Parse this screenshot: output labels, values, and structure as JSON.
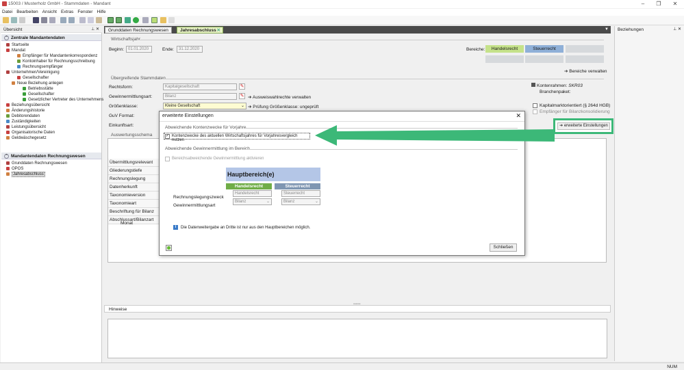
{
  "window": {
    "title": "15003 / Musterholz GmbH - Stammdaten - Mandant",
    "status": "NUM"
  },
  "menu": [
    "Datei",
    "Bearbeiten",
    "Ansicht",
    "Extras",
    "Fenster",
    "Hilfe"
  ],
  "left_panel": {
    "title": "Übersicht",
    "sections": [
      {
        "title": "Zentrale Mandantendaten",
        "items": [
          {
            "label": "Startseite",
            "level": 0
          },
          {
            "label": "Mandat",
            "level": 0
          },
          {
            "label": "Empfänger für Mandantenkorrespondenz",
            "level": 2
          },
          {
            "label": "Kontoinhaber für Rechnungsschreibung",
            "level": 2
          },
          {
            "label": "Rechnungsempfänger",
            "level": 2
          },
          {
            "label": "Unternehmen/Vereinigung",
            "level": 0
          },
          {
            "label": "Gesellschafter",
            "level": 2
          },
          {
            "label": "Neue Beziehung anlegen",
            "level": 1
          },
          {
            "label": "Betriebsstätte",
            "level": 3
          },
          {
            "label": "Gesellschafter",
            "level": 3
          },
          {
            "label": "Gesetzlicher Vertreter des Unternehmens",
            "level": 3
          },
          {
            "label": "Beziehungsübersicht",
            "level": 0
          },
          {
            "label": "Änderungshistorie",
            "level": 0
          },
          {
            "label": "Debitorendaten",
            "level": 0
          },
          {
            "label": "Zuständigkeiten",
            "level": 0
          },
          {
            "label": "Leistungsübersicht",
            "level": 0
          },
          {
            "label": "Organisatorische Daten",
            "level": 0
          },
          {
            "label": "Geldwäschegesetz",
            "level": 0
          }
        ]
      },
      {
        "title": "Mandantendaten Rechnungswesen",
        "items": [
          {
            "label": "Grunddaten Rechnungswesen",
            "level": 0
          },
          {
            "label": "OPOS",
            "level": 0
          },
          {
            "label": "Jahresabschluss",
            "level": 0,
            "selected": true
          }
        ]
      }
    ]
  },
  "tabs": [
    {
      "label": "Grunddaten Rechnungswesen",
      "active": false
    },
    {
      "label": "Jahresabschluss",
      "active": true
    }
  ],
  "main": {
    "wirtschaftsjahr": {
      "group": "Wirtschaftsjahr",
      "beginn_label": "Beginn:",
      "beginn": "01.01.2020",
      "ende_label": "Ende:",
      "ende": "31.12.2020"
    },
    "bereiche": {
      "label": "Bereiche:",
      "handelsrecht": "Handelsrecht",
      "steuerrecht": "Steuerrecht",
      "verwalten": "Bereiche verwalten"
    },
    "stammdaten": {
      "group": "Übergreifende Stammdaten",
      "rechtsform_label": "Rechtsform:",
      "rechtsform": "Kapitalgesellschaft",
      "gewinn_label": "Gewinnermittlungsart:",
      "gewinn": "Bilanz",
      "ausweis": "Ausweiswahlrechte verwalten",
      "groesse_label": "Größenklasse:",
      "groesse": "Kleine Gesellschaft",
      "pruefung": "Prüfung Größenklasse: ungeprüft",
      "guv_label": "GuV Format:",
      "einkunft_label": "Einkunftsart:"
    },
    "kontenrahmen_label": "Kontenrahmen:",
    "kontenrahmen": "SKR03",
    "branchenpaket_label": "Branchenpaket:",
    "kapitalmarkt": "Kapitalmarktorientiert (§ 264d HGB)",
    "empfaenger": "Empfänger für Bilanzkonsolidierung",
    "erweitert_btn": "erweiterte Einstellungen",
    "schema": {
      "group": "Auswertungsschema",
      "rows": [
        "Übermittlungsrelevant",
        "Gliederungstiefe",
        "Rechnungslegung",
        "Datenherkunft",
        "Taxonomieversion",
        "Taxonomieart",
        "Beschriftung für Bilanz",
        "Abschlussart/Bilanzart"
      ],
      "monat": "Monat"
    }
  },
  "hinweise": {
    "title": "Hinweise"
  },
  "right_panel": {
    "title": "Beziehungen"
  },
  "dialog": {
    "title": "erweiterte Einstellungen",
    "group1": "Abweichende Kontenzwecke für Vorjahre",
    "checkbox1": "Kontenzwecke des aktuellen Wirtschaftsjahres für Vorjahresvergleich nutzen",
    "group2": "Abweichende Gewinnermittlung im Bereich",
    "checkbox2": "Bereichsabweichende Gewinnermittlung aktivieren",
    "hauptbereich": "Hauptbereich(e)",
    "col_handel": "Handelsrecht",
    "col_steuer": "Steuerrecht",
    "row1_label": "Rechnungslegungszweck",
    "row2_label": "Gewinnermittlungsart",
    "rl_handel": "Handelsrecht",
    "rl_steuer": "Steuerrecht",
    "ga_handel": "Bilanz",
    "ga_steuer": "Bilanz",
    "info": "Die Datenweitergabe an Dritte ist nur aus den Hauptbereichen möglich.",
    "close": "Schließen"
  },
  "colors": {
    "accent_green": "#3cb878",
    "tab_active": "#e8f3c6",
    "bereich_handel": "#c5e28a",
    "bereich_steuer": "#8fb0d8",
    "hdr_handel": "#70ad47",
    "hdr_steuer": "#7f96b2"
  }
}
